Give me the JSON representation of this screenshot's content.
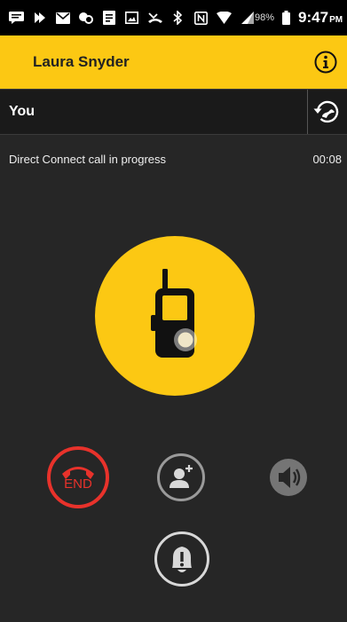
{
  "status_bar": {
    "battery_percent": "98%",
    "time": "9:47",
    "ampm": "PM"
  },
  "header": {
    "contact_name": "Laura Snyder"
  },
  "user_bar": {
    "label": "You"
  },
  "call": {
    "status_text": "Direct Connect call in progress",
    "duration": "00:08"
  },
  "controls": {
    "end_label": "END"
  },
  "colors": {
    "accent": "#fcc813",
    "end_red": "#e8322b",
    "background": "#262626"
  },
  "icons": [
    "notification-icons",
    "bluetooth-icon",
    "wifi-icon",
    "signal-icon",
    "battery-icon",
    "info-icon",
    "call-history-icon",
    "walkie-talkie-icon",
    "end-call-icon",
    "add-participant-icon",
    "speaker-icon",
    "alert-icon"
  ]
}
